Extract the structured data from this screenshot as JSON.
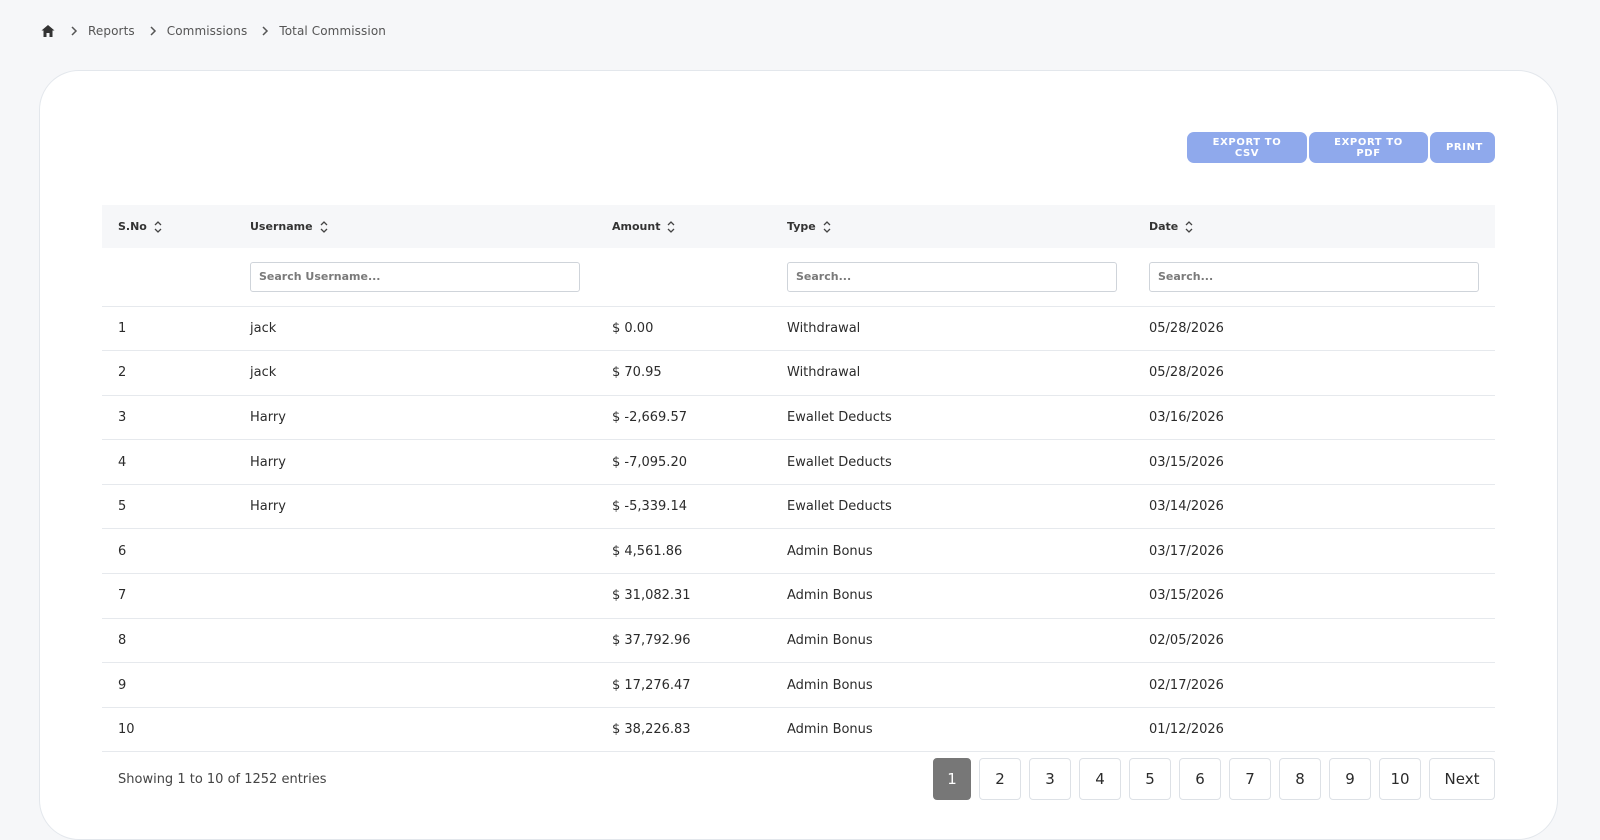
{
  "breadcrumb": {
    "items": [
      "Reports",
      "Commissions",
      "Total Commission"
    ]
  },
  "toolbar": {
    "export_csv_label": "EXPORT TO CSV",
    "export_pdf_label": "EXPORT TO PDF",
    "print_label": "PRINT",
    "button_color": "#8fa9ec"
  },
  "table": {
    "columns": [
      "S.No",
      "Username",
      "Amount",
      "Type",
      "Date"
    ],
    "filters": {
      "username_placeholder": "Search Username...",
      "type_placeholder": "Search...",
      "date_placeholder": "Search..."
    },
    "rows": [
      {
        "sno": "1",
        "username": "jack",
        "amount": "$ 0.00",
        "type": "Withdrawal",
        "date": "05/28/2026"
      },
      {
        "sno": "2",
        "username": "jack",
        "amount": "$ 70.95",
        "type": "Withdrawal",
        "date": "05/28/2026"
      },
      {
        "sno": "3",
        "username": "Harry",
        "amount": "$ -2,669.57",
        "type": "Ewallet Deducts",
        "date": "03/16/2026"
      },
      {
        "sno": "4",
        "username": "Harry",
        "amount": "$ -7,095.20",
        "type": "Ewallet Deducts",
        "date": "03/15/2026"
      },
      {
        "sno": "5",
        "username": "Harry",
        "amount": "$ -5,339.14",
        "type": "Ewallet Deducts",
        "date": "03/14/2026"
      },
      {
        "sno": "6",
        "username": "",
        "amount": "$ 4,561.86",
        "type": "Admin Bonus",
        "date": "03/17/2026"
      },
      {
        "sno": "7",
        "username": "",
        "amount": "$ 31,082.31",
        "type": "Admin Bonus",
        "date": "03/15/2026"
      },
      {
        "sno": "8",
        "username": "",
        "amount": "$ 37,792.96",
        "type": "Admin Bonus",
        "date": "02/05/2026"
      },
      {
        "sno": "9",
        "username": "",
        "amount": "$ 17,276.47",
        "type": "Admin Bonus",
        "date": "02/17/2026"
      },
      {
        "sno": "10",
        "username": "",
        "amount": "$ 38,226.83",
        "type": "Admin Bonus",
        "date": "01/12/2026"
      }
    ]
  },
  "footer": {
    "entries_text": "Showing 1 to 10 of 1252 entries",
    "pages": [
      "1",
      "2",
      "3",
      "4",
      "5",
      "6",
      "7",
      "8",
      "9",
      "10"
    ],
    "current_page": "1",
    "next_label": "Next"
  }
}
